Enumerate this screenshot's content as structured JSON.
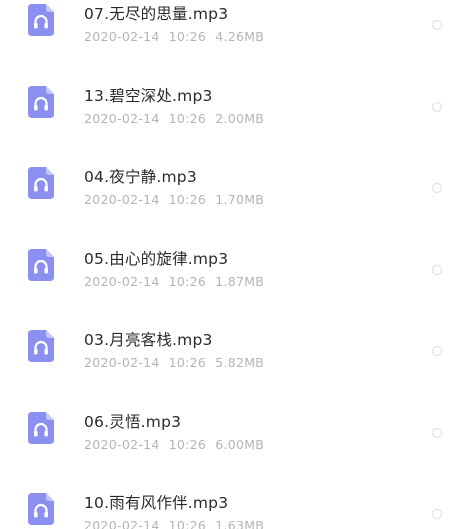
{
  "files": [
    {
      "name": "07.无尽的思量.mp3",
      "date": "2020-02-14",
      "time": "10:26",
      "size": "4.26MB",
      "icon": "headphone-file-icon"
    },
    {
      "name": "13.碧空深处.mp3",
      "date": "2020-02-14",
      "time": "10:26",
      "size": "2.00MB",
      "icon": "headphone-file-icon"
    },
    {
      "name": "04.夜宁静.mp3",
      "date": "2020-02-14",
      "time": "10:26",
      "size": "1.70MB",
      "icon": "headphone-file-icon"
    },
    {
      "name": "05.由心的旋律.mp3",
      "date": "2020-02-14",
      "time": "10:26",
      "size": "1.87MB",
      "icon": "headphone-file-icon"
    },
    {
      "name": "03.月亮客栈.mp3",
      "date": "2020-02-14",
      "time": "10:26",
      "size": "5.82MB",
      "icon": "headphone-file-icon"
    },
    {
      "name": "06.灵悟.mp3",
      "date": "2020-02-14",
      "time": "10:26",
      "size": "6.00MB",
      "icon": "headphone-file-icon"
    },
    {
      "name": "10.雨有风作伴.mp3",
      "date": "2020-02-14",
      "time": "10:26",
      "size": "1.63MB",
      "icon": "headphone-file-icon"
    }
  ],
  "colors": {
    "icon_fill": "#8a8ff0",
    "icon_fold": "#c3c6f8",
    "title_text": "#2b2b2b",
    "meta_text": "#b5b5b5",
    "radio_border": "#dcdcdc"
  }
}
